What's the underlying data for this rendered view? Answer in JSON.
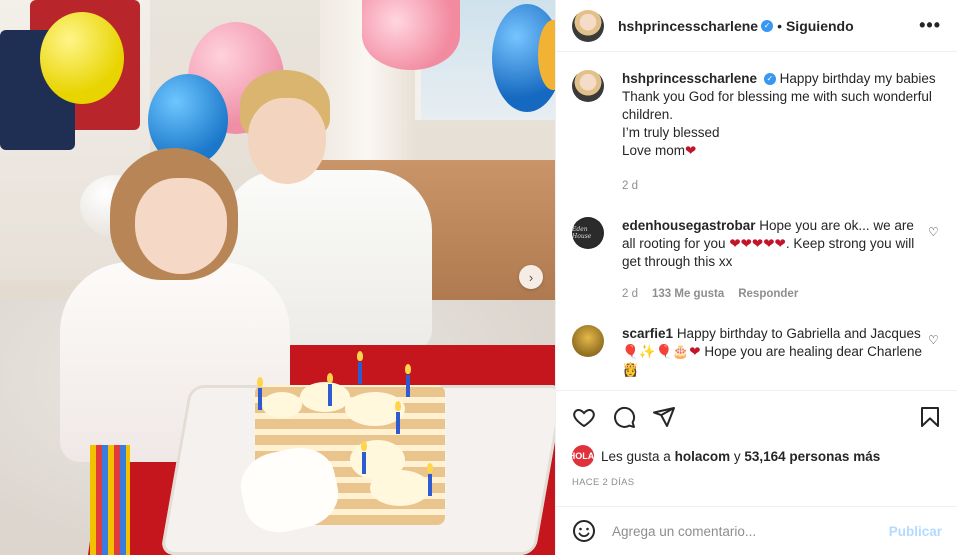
{
  "post": {
    "username": "hshprincesscharlene",
    "separator": "•",
    "follow_status": "Siguiendo",
    "more_icon": "more-horizontal-icon",
    "next_icon": "chevron-right-icon"
  },
  "caption": {
    "username": "hshprincesscharlene",
    "lines": [
      "Happy birthday my babies",
      "Thank you God for blessing me with such wonderful children.",
      "I’m truly blessed",
      "Love mom"
    ],
    "heart": "❤",
    "time": "2 d"
  },
  "comments": [
    {
      "username": "edenhousegastrobar",
      "avatar_text": "Eden House",
      "text_a": "Hope you are ok... we are all rooting for you ",
      "hearts": "❤❤❤❤❤",
      "text_b": ". Keep strong you will get through this xx",
      "time": "2 d",
      "likes": "133 Me gusta",
      "reply": "Responder"
    },
    {
      "username": "scarfie1",
      "text_a": "Happy birthday to Gabriella and Jacques",
      "emojis": "🎈✨🎈🎂",
      "heart": "❤",
      "text_b": " Hope you are healing dear Charlene",
      "end_emoji": "👸"
    }
  ],
  "likes": {
    "avatar_text": "HOLA!",
    "prefix": "Les gusta a",
    "user": "holacom",
    "connector": "y",
    "count": "53,164 personas más"
  },
  "timestamp": "HACE 2 DÍAS",
  "comment_input": {
    "placeholder": "Agrega un comentario...",
    "publish": "Publicar"
  },
  "colors": {
    "text": "#262626",
    "muted": "#8e8e8e",
    "verified": "#3897f0",
    "heart_red": "#c0152a",
    "publish_disabled": "#b3dbff"
  }
}
